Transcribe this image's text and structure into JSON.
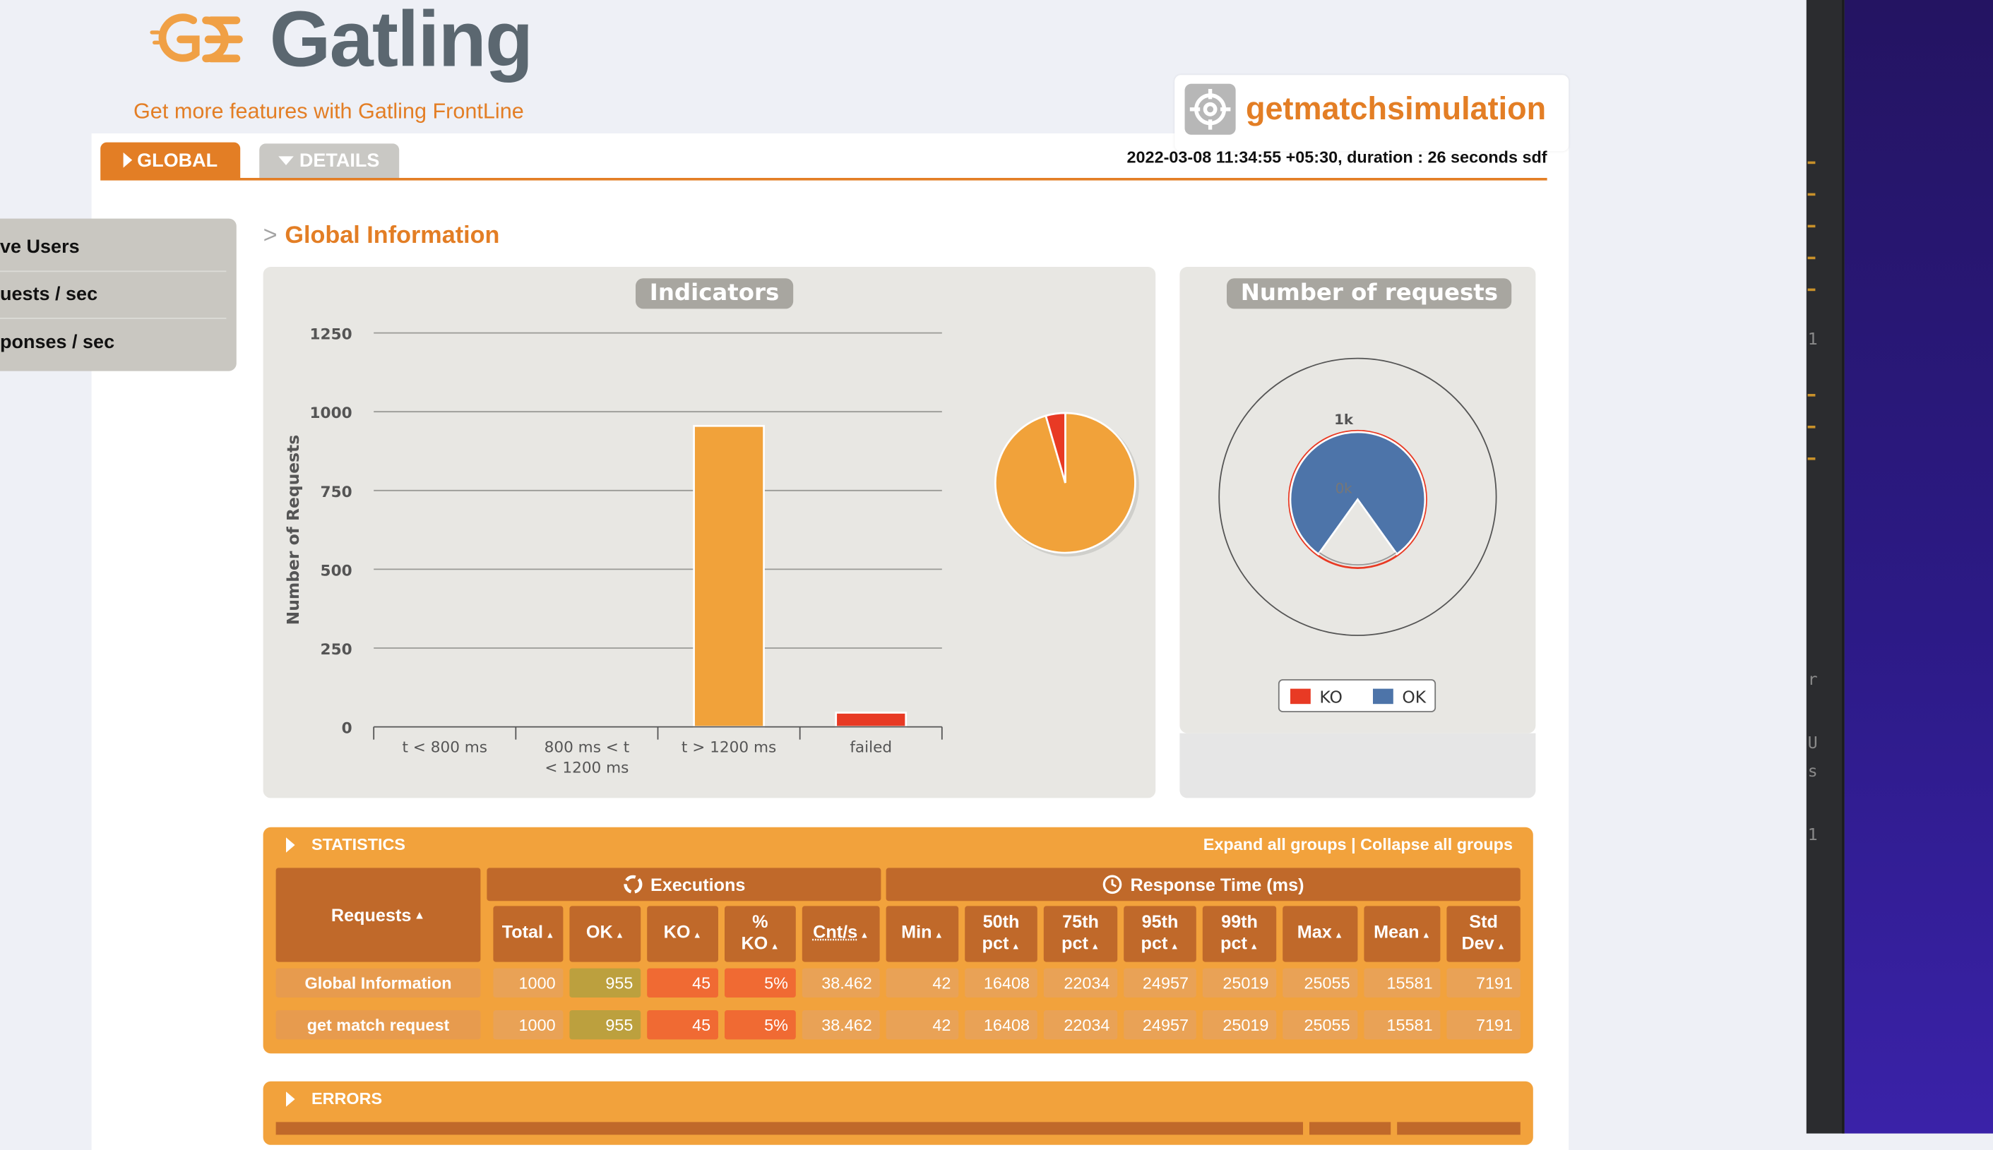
{
  "brand": {
    "logo_text": "Gatling",
    "tagline": "Get more features with Gatling FrontLine"
  },
  "simulation": {
    "name": "getmatchsimulation",
    "run_info": "2022-03-08 11:34:55 +05:30, duration : 26 seconds sdf"
  },
  "tabs": {
    "global": "GLOBAL",
    "details": "DETAILS"
  },
  "side_menu": {
    "items": [
      "ve Users",
      "uests / sec",
      "ponses / sec"
    ]
  },
  "section_title": "Global Information",
  "indicators": {
    "title": "Indicators",
    "ylabel": "Number of Requests",
    "yticks": [
      "0",
      "250",
      "500",
      "750",
      "1000",
      "1250"
    ],
    "categories": [
      "t < 800 ms",
      "800 ms < t < 1200 ms",
      "t > 1200 ms",
      "failed"
    ]
  },
  "requests_panel": {
    "title": "Number of requests",
    "inner_labels": {
      "top": "1k",
      "center": "0k"
    },
    "legend": [
      "KO",
      "OK"
    ]
  },
  "chart_data": [
    {
      "type": "bar",
      "title": "Indicators",
      "ylabel": "Number of Requests",
      "ylim": [
        0,
        1250
      ],
      "categories": [
        "t < 800 ms",
        "800 ms < t < 1200 ms",
        "t > 1200 ms",
        "failed"
      ],
      "values": [
        0,
        0,
        955,
        45
      ],
      "colors": [
        "#f1a23a",
        "#f1a23a",
        "#f1a23a",
        "#e83a24"
      ],
      "grid": true
    },
    {
      "type": "pie",
      "categories": [
        "t > 1200 ms",
        "failed"
      ],
      "values": [
        955,
        45
      ],
      "colors": [
        "#f1a23a",
        "#e83a24"
      ]
    },
    {
      "type": "pie",
      "title": "Number of requests",
      "categories": [
        "KO",
        "OK"
      ],
      "values": [
        45,
        955
      ],
      "colors": [
        "#e83a24",
        "#4d74a9"
      ],
      "legend": "bottom"
    }
  ],
  "statistics": {
    "title": "STATISTICS",
    "expand_label": "Expand all groups",
    "collapse_label": "Collapse all groups",
    "group_executions": "Executions",
    "group_response": "Response Time (ms)",
    "col_requests": "Requests",
    "columns": [
      [
        "Total"
      ],
      [
        "OK"
      ],
      [
        "KO"
      ],
      [
        "%",
        "KO"
      ],
      [
        "Cnt/s"
      ],
      [
        "Min"
      ],
      [
        "50th",
        "pct"
      ],
      [
        "75th",
        "pct"
      ],
      [
        "95th",
        "pct"
      ],
      [
        "99th",
        "pct"
      ],
      [
        "Max"
      ],
      [
        "Mean"
      ],
      [
        "Std",
        "Dev"
      ]
    ],
    "rows": [
      {
        "name": "Global Information",
        "values": [
          "1000",
          "955",
          "45",
          "5%",
          "38.462",
          "42",
          "16408",
          "22034",
          "24957",
          "25019",
          "25055",
          "15581",
          "7191"
        ]
      },
      {
        "name": "get match request",
        "values": [
          "1000",
          "955",
          "45",
          "5%",
          "38.462",
          "42",
          "16408",
          "22034",
          "24957",
          "25019",
          "25055",
          "15581",
          "7191"
        ]
      }
    ]
  },
  "errors": {
    "title": "ERRORS"
  },
  "right_panel": {
    "chars": [
      "1",
      "r",
      "U",
      "s",
      "1"
    ]
  },
  "colors": {
    "accent": "#e37e25",
    "ok_bar": "#f1a23a",
    "failed": "#e83a24",
    "ok_blue": "#4d74a9"
  }
}
